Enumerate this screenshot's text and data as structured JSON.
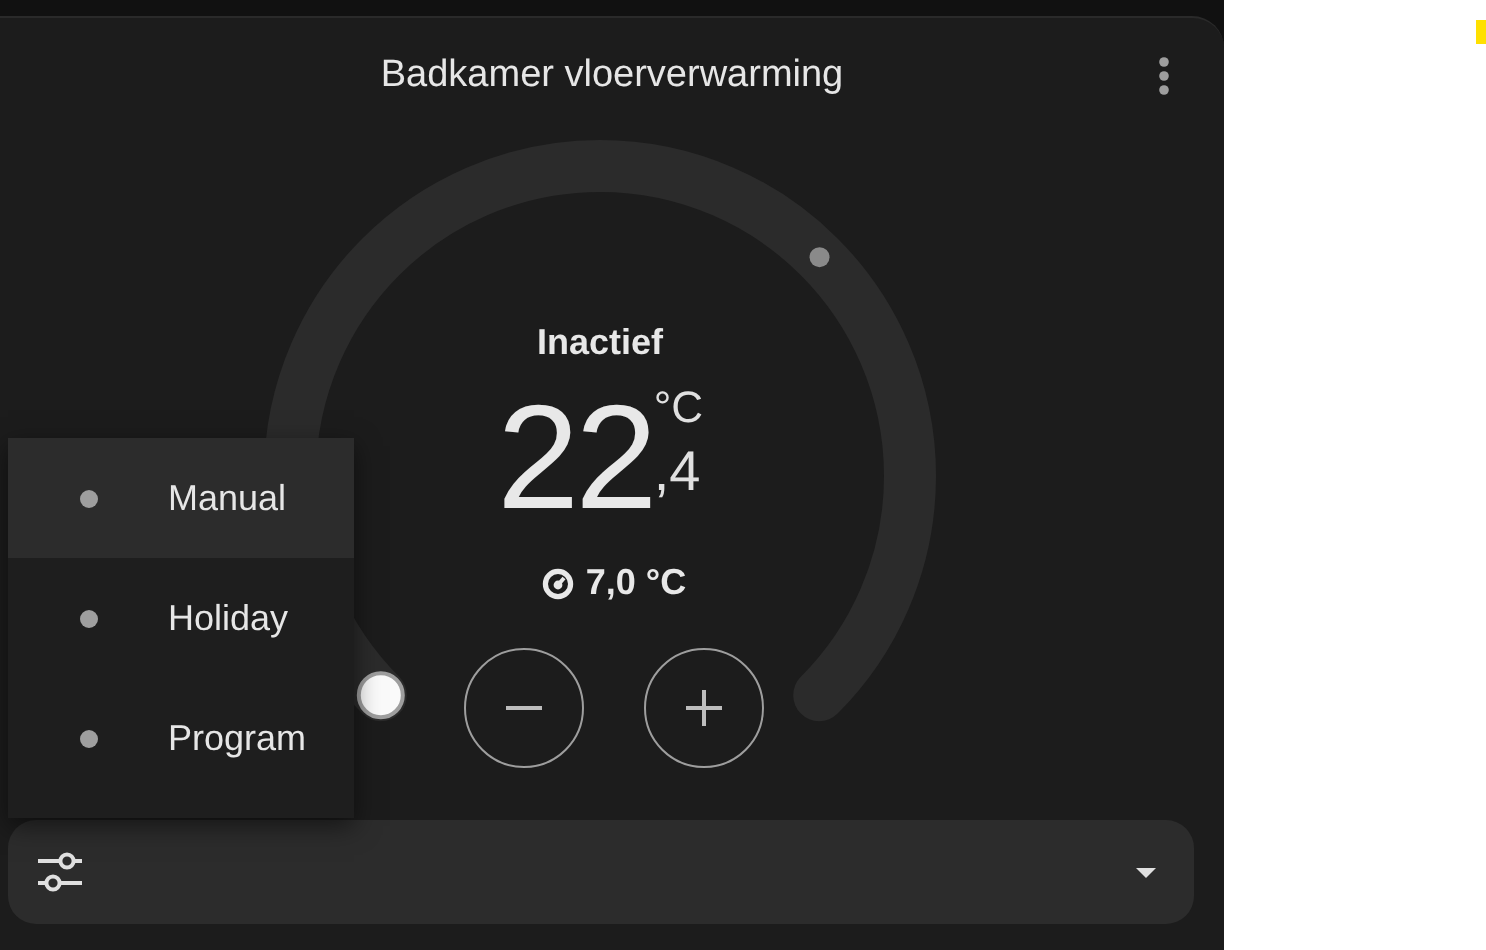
{
  "card": {
    "title": "Badkamer vloerverwarming"
  },
  "dial": {
    "status": "Inactief",
    "current_temperature": {
      "integer": "22",
      "decimal": ",4",
      "unit": "°C"
    },
    "target": "7,0 °C"
  },
  "mode_menu": {
    "items": [
      {
        "label": "Manual",
        "selected": true
      },
      {
        "label": "Holiday",
        "selected": false
      },
      {
        "label": "Program",
        "selected": false
      }
    ]
  }
}
